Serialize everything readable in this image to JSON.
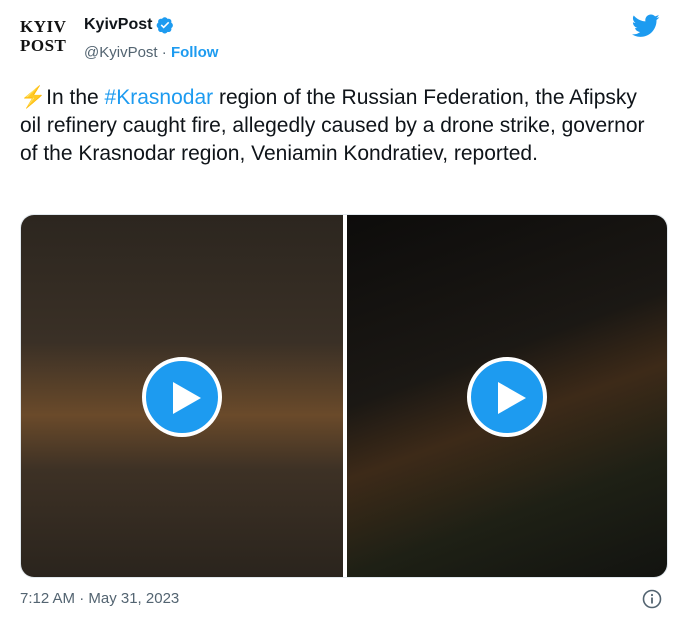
{
  "header": {
    "logo_line1": "KYIV",
    "logo_line2": "POST",
    "display_name": "KyivPost",
    "handle": "@KyivPost",
    "separator": "·",
    "follow_label": "Follow"
  },
  "tweet": {
    "bolt": "⚡",
    "text_before": "In the ",
    "hashtag": "#Krasnodar",
    "text_after": " region of the Russian Federation, the Afipsky oil refinery caught fire, allegedly caused by a drone strike, governor of the Krasnodar region, Veniamin Kondratiev, reported."
  },
  "footer": {
    "timestamp": "7:12 AM · May 31, 2023"
  },
  "icons": {
    "verified": "verified-badge-icon",
    "bird": "twitter-bird-icon",
    "play": "play-icon",
    "info": "info-icon"
  },
  "colors": {
    "accent": "#1d9bf0",
    "text": "#0f1419",
    "muted": "#536471"
  }
}
